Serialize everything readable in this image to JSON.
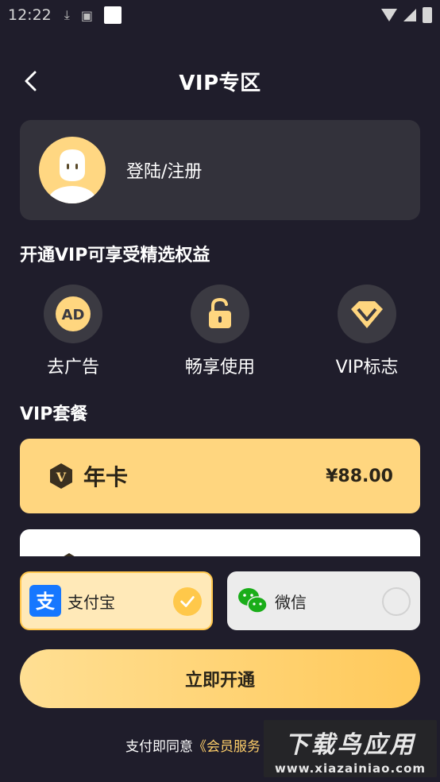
{
  "status_bar": {
    "time": "12:22"
  },
  "header": {
    "title": "VIP专区"
  },
  "user": {
    "login_label": "登陆/注册"
  },
  "benefits": {
    "title": "开通VIP可享受精选权益",
    "items": [
      {
        "label": "去广告",
        "icon": "ad-icon"
      },
      {
        "label": "畅享使用",
        "icon": "unlock-icon"
      },
      {
        "label": "VIP标志",
        "icon": "diamond-icon"
      }
    ]
  },
  "plans": {
    "title": "VIP套餐",
    "items": [
      {
        "name": "年卡",
        "price": "¥88.00",
        "badge": "V",
        "selected": true
      }
    ]
  },
  "payment": {
    "options": [
      {
        "label": "支付宝",
        "icon": "alipay-icon",
        "selected": true
      },
      {
        "label": "微信",
        "icon": "wechat-icon",
        "selected": false
      }
    ]
  },
  "cta": {
    "label": "立即开通"
  },
  "agreement": {
    "prefix": "支付即同意",
    "link": "《会员服务"
  },
  "watermark": {
    "title": "下载鸟应用",
    "url": "www.xiazainiao.com"
  },
  "colors": {
    "background": "#1f1d2b",
    "card": "#33323b",
    "accent": "#ffd67f",
    "accent_strong": "#ffc84a"
  }
}
